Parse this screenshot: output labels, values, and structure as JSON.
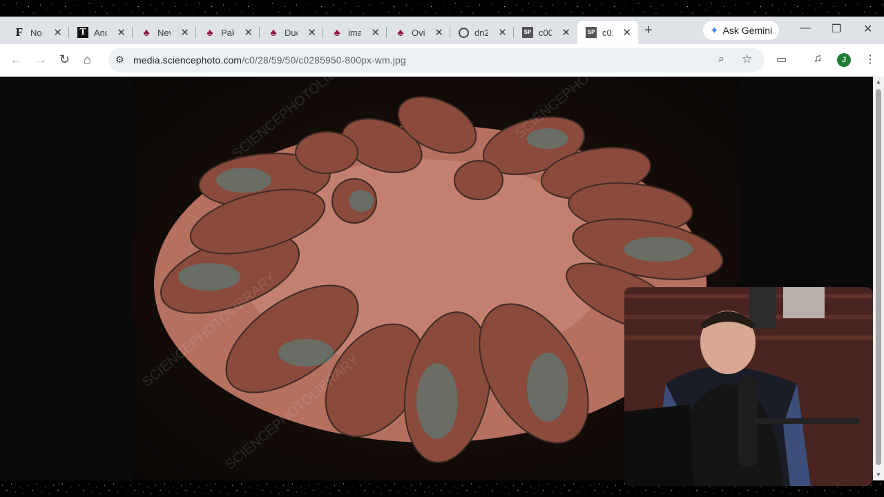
{
  "tabs": [
    {
      "title": "No",
      "favicon": "f-logo-icon"
    },
    {
      "title": "Anc",
      "favicon": "t-logo-icon"
    },
    {
      "title": "Nev",
      "favicon": "tree-logo-icon"
    },
    {
      "title": "Pak",
      "favicon": "tree-logo-icon"
    },
    {
      "title": "Duc",
      "favicon": "tree-logo-icon"
    },
    {
      "title": "ima",
      "favicon": "tree-logo-icon"
    },
    {
      "title": "Ovi",
      "favicon": "tree-logo-icon"
    },
    {
      "title": "dn2",
      "favicon": "globe-icon"
    },
    {
      "title": "c00",
      "favicon": "sp-logo-icon"
    },
    {
      "title": "c02",
      "favicon": "sp-logo-icon",
      "active": true
    }
  ],
  "gemini": {
    "label": "Ask Gemini"
  },
  "omnibox": {
    "domain": "media.sciencephoto.com",
    "path": "/c0/28/59/50/c0285950-800px-wm.jpg"
  },
  "profile": {
    "initial": "J",
    "color": "#1e7d32"
  },
  "photo": {
    "watermark": "SCIENCEPHOTOLIBRARY",
    "subject": "fossilized dinosaur egg clutch"
  },
  "webcam": {
    "subject": "streamer with microphone"
  }
}
